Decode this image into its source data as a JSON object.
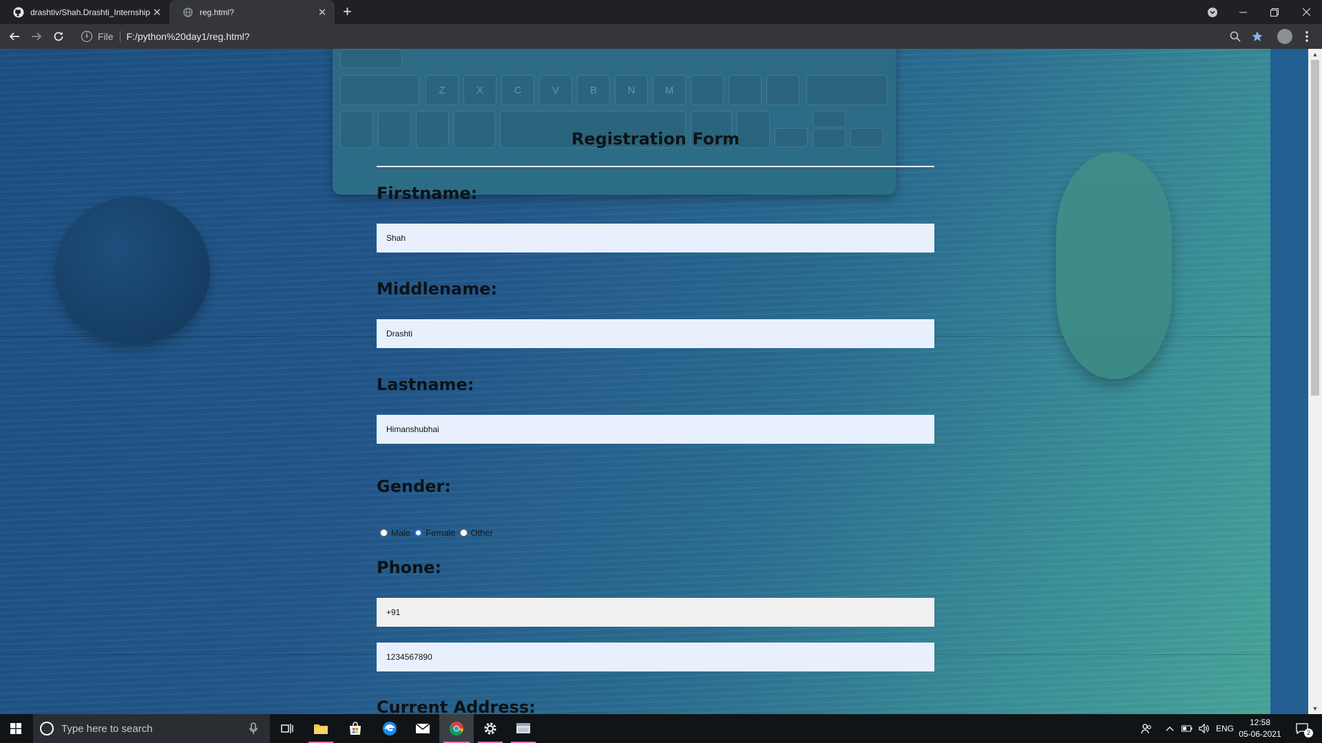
{
  "browser": {
    "tabs": [
      {
        "title": "drashtiv/Shah.Drashti_Internship",
        "icon": "github-icon",
        "active": false
      },
      {
        "title": "reg.html?",
        "icon": "globe-icon",
        "active": true
      }
    ],
    "new_tab": "+",
    "address": {
      "scheme": "File",
      "url": "F:/python%20day1/reg.html?"
    }
  },
  "form": {
    "title": "Registration Form",
    "firstname": {
      "label": "Firstname:",
      "value": "Shah"
    },
    "middlename": {
      "label": "Middlename:",
      "value": "Drashti"
    },
    "lastname": {
      "label": "Lastname:",
      "value": "Himanshubhai"
    },
    "gender": {
      "label": "Gender:",
      "options": [
        "Male",
        "Female",
        "Other"
      ],
      "selected": "Female"
    },
    "phone": {
      "label": "Phone:",
      "code": "+91",
      "number": "1234567890"
    },
    "address": {
      "label": "Current Address:"
    }
  },
  "taskbar": {
    "search_placeholder": "Type here to search",
    "language": "ENG",
    "time": "12:58",
    "date": "05-06-2021",
    "notification_count": "2"
  },
  "colors": {
    "checked_radio": "#1a73e8",
    "autofill_field": "#e8f0fe",
    "active_app_underline": "#e86fb0"
  }
}
